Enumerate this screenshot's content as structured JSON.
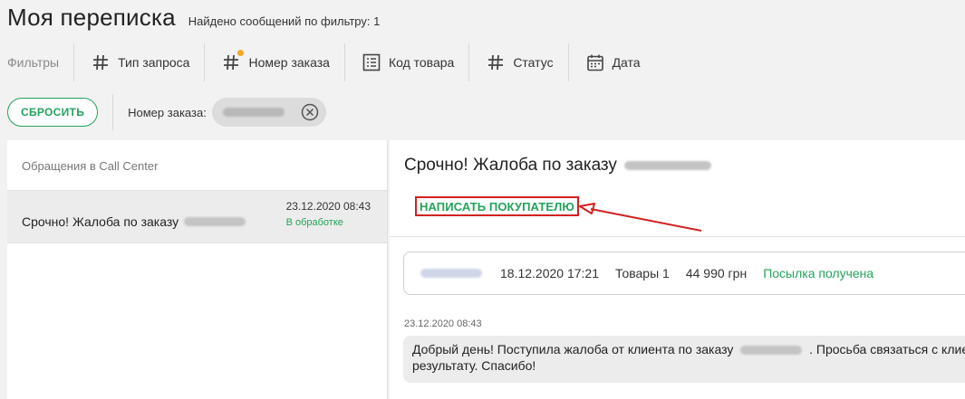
{
  "header": {
    "title": "Моя переписка",
    "found_label": "Найдено сообщений по фильтру:",
    "found_count": "1"
  },
  "filters": {
    "label": "Фильтры",
    "items": [
      {
        "label": "Тип запроса",
        "icon": "hash-icon"
      },
      {
        "label": "Номер заказа",
        "icon": "hash-icon",
        "active_dot": true
      },
      {
        "label": "Код товара",
        "icon": "list-icon"
      },
      {
        "label": "Статус",
        "icon": "hash-icon"
      },
      {
        "label": "Дата",
        "icon": "calendar-icon"
      }
    ]
  },
  "active_filters": {
    "reset_label": "СБРОСИТЬ",
    "chip_label": "Номер заказа:"
  },
  "left_panel": {
    "heading": "Обращения в Call Center",
    "conversations": [
      {
        "title": "Срочно! Жалоба по заказу",
        "date": "23.12.2020 08:43",
        "status": "В обработке"
      }
    ]
  },
  "detail": {
    "title": "Срочно! Жалоба по заказу",
    "write_label": "НАПИСАТЬ ПОКУПАТЕЛЮ",
    "order": {
      "date": "18.12.2020 17:21",
      "items": "Товары 1",
      "amount": "44 990 грн",
      "status": "Посылка получена"
    },
    "message": {
      "date": "23.12.2020 08:43",
      "text_part1": "Добрый день! Поступила жалоба от клиента по заказу",
      "text_part2": ". Просьба связаться с клие",
      "text_part3": "результату. Спасибо!"
    }
  },
  "colors": {
    "accent_green": "#23a35a",
    "highlight_red": "#d32020",
    "dot_orange": "#f5a623"
  }
}
